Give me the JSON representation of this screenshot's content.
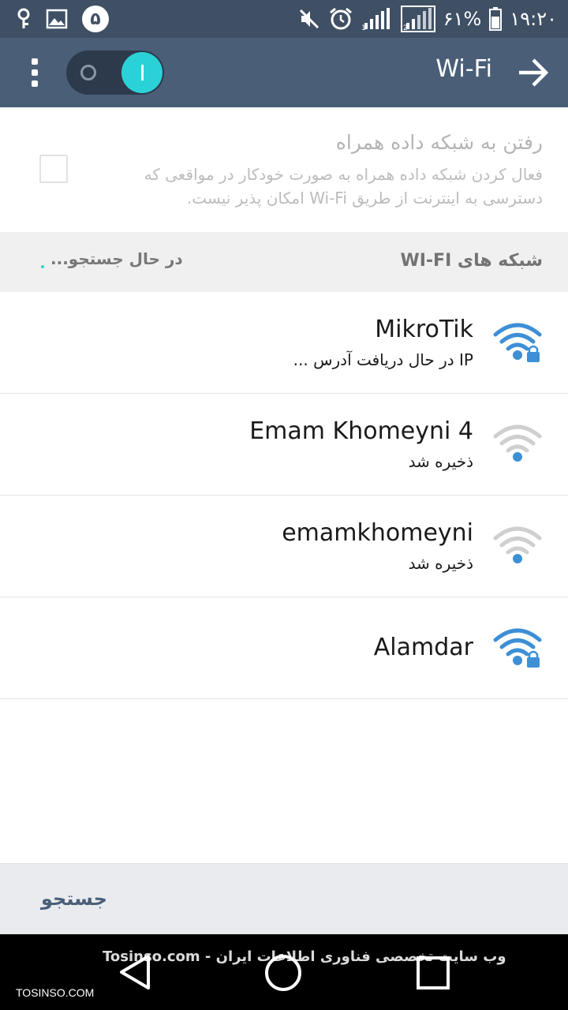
{
  "status_bar": {
    "notification_count": "۵",
    "battery": "۶۱%",
    "time": "۱۹:۲۰",
    "icons_left": [
      "location-key-icon",
      "gallery-icon"
    ],
    "icons_right": [
      "mute-icon",
      "alarm-icon",
      "signal-sim1-icon",
      "signal-sim2-icon",
      "battery-icon"
    ]
  },
  "action_bar": {
    "title": "Wi-Fi",
    "toggle_state": "on",
    "accent_color": "#2ad2d8"
  },
  "mobile_data": {
    "title": "رفتن به شبکه داده همراه",
    "description": "فعال کردن شبکه داده همراه به صورت خودکار در مواقعی که دسترسی به اینترنت از طریق Wi-Fi امکان پذیر نیست.",
    "checked": false
  },
  "networks_header": {
    "title": "شبکه های WI-FI",
    "status": "در حال جستجو..."
  },
  "networks": [
    {
      "name": "MikroTik",
      "status": "IP در حال دریافت آدرس ...",
      "signal_color": "blue",
      "locked": true
    },
    {
      "name": "Emam Khomeyni 4",
      "status": "ذخیره شد",
      "signal_color": "gray",
      "locked": false
    },
    {
      "name": "emamkhomeyni",
      "status": "ذخیره شد",
      "signal_color": "gray",
      "locked": false
    },
    {
      "name": "Alamdar",
      "status": "",
      "signal_color": "blue",
      "locked": true
    }
  ],
  "footer": {
    "search_label": "جستجو"
  },
  "watermark": {
    "main": "Tosinso.com - وب سایت تخصصی فناوری اطلاعات ایران",
    "small": "TOSINSO.COM"
  }
}
